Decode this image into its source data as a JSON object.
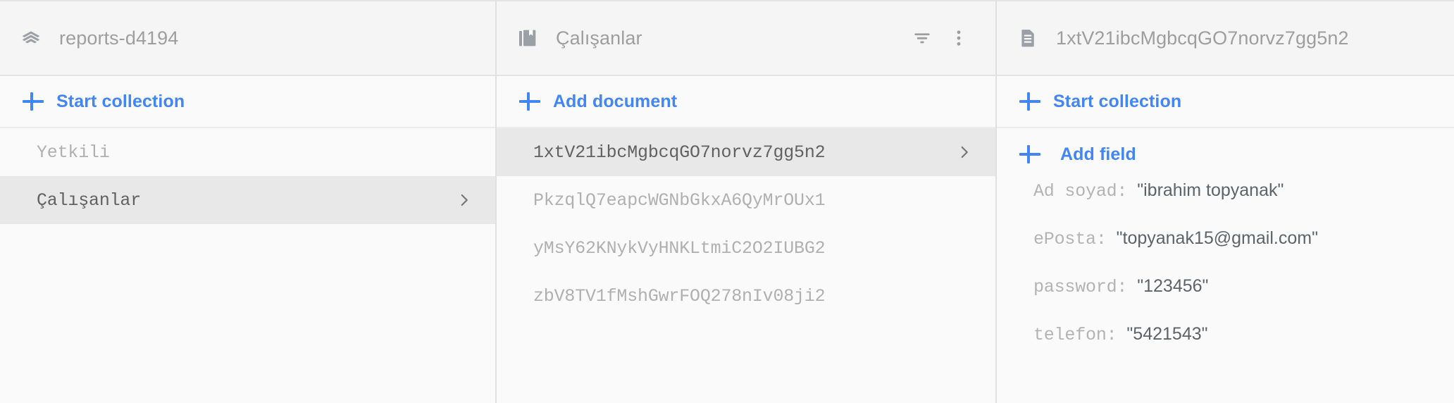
{
  "panels": {
    "collections": {
      "header": {
        "icon": "firebase-stack-icon",
        "title": "reports-d4194"
      },
      "add_action": {
        "icon": "plus-icon",
        "label": "Start collection"
      },
      "items": [
        {
          "name": "Yetkili",
          "selected": false
        },
        {
          "name": "Çalışanlar",
          "selected": true
        }
      ]
    },
    "documents": {
      "header": {
        "icon": "collection-library-icon",
        "title": "Çalışanlar",
        "actions": [
          {
            "icon": "filter-icon",
            "name": "filter-documents"
          },
          {
            "icon": "more-vert-icon",
            "name": "documents-overflow-menu"
          }
        ]
      },
      "add_action": {
        "icon": "plus-icon",
        "label": "Add document"
      },
      "items": [
        {
          "name": "1xtV21ibcMgbcqGO7norvz7gg5n2",
          "selected": true
        },
        {
          "name": "PkzqlQ7eapcWGNbGkxA6QyMrOUx1",
          "selected": false
        },
        {
          "name": "yMsY62KNykVyHNKLtmiC2O2IUBG2",
          "selected": false
        },
        {
          "name": "zbV8TV1fMshGwrFOQ278nIv08ji2",
          "selected": false
        }
      ]
    },
    "document_detail": {
      "header": {
        "icon": "document-icon",
        "title": "1xtV21ibcMgbcqGO7norvz7gg5n2"
      },
      "start_collection_action": {
        "icon": "plus-icon",
        "label": "Start collection"
      },
      "add_field_action": {
        "icon": "plus-icon",
        "label": "Add field"
      },
      "fields": [
        {
          "key": "Ad soyad:",
          "value": "\"ibrahim topyanak\""
        },
        {
          "key": "ePosta:",
          "value": "\"topyanak15@gmail.com\""
        },
        {
          "key": "password:",
          "value": "\"123456\""
        },
        {
          "key": "telefon:",
          "value": "\"5421543\""
        }
      ]
    }
  },
  "colors": {
    "accent": "#4285f4",
    "selected_row_bg": "#e8e8e8",
    "header_bg": "#f5f5f5",
    "panel_bg": "#fafafa",
    "divider": "#e0e0e0",
    "muted_text": "#b0b0b0",
    "strong_text": "#5f6368"
  }
}
